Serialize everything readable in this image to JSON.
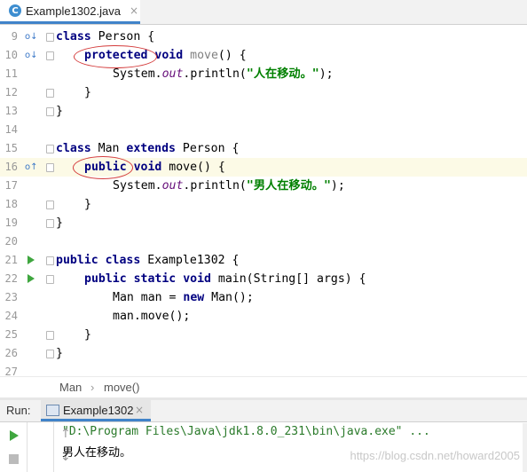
{
  "tab": {
    "icon": "C",
    "label": "Example1302.java",
    "close": "×"
  },
  "lines": [
    {
      "n": "9"
    },
    {
      "n": "10"
    },
    {
      "n": "11"
    },
    {
      "n": "12"
    },
    {
      "n": "13"
    },
    {
      "n": "14"
    },
    {
      "n": "15"
    },
    {
      "n": "16"
    },
    {
      "n": "17"
    },
    {
      "n": "18"
    },
    {
      "n": "19"
    },
    {
      "n": "20"
    },
    {
      "n": "21"
    },
    {
      "n": "22"
    },
    {
      "n": "23"
    },
    {
      "n": "24"
    },
    {
      "n": "25"
    },
    {
      "n": "26"
    },
    {
      "n": "27"
    }
  ],
  "code": {
    "l9": {
      "kw1": "class",
      "t1": " Person {"
    },
    "l10": {
      "kw1": "protected",
      "gap": " ",
      "kw2": "void",
      "g1": " move",
      "t1": "() {"
    },
    "l11": {
      "t1": "System.",
      "fld": "out",
      "t2": ".println(",
      "str": "\"人在移动。\"",
      "t3": ");"
    },
    "l12": {
      "t1": "}"
    },
    "l13": {
      "t1": "}"
    },
    "l15": {
      "kw1": "class",
      "t1": " Man ",
      "kw2": "extends",
      "t2": " Person {"
    },
    "l16": {
      "kw1": "public",
      "gap": " ",
      "kw2": "void",
      "t1": " move() {"
    },
    "l17": {
      "t1": "System.",
      "fld": "out",
      "t2": ".println(",
      "str": "\"男人在移动。\"",
      "t3": ");"
    },
    "l18": {
      "t1": "}"
    },
    "l19": {
      "t1": "}"
    },
    "l21": {
      "kw1": "public",
      "gap1": " ",
      "kw2": "class",
      "t1": " Example1302 {"
    },
    "l22": {
      "kw1": "public",
      "gap1": " ",
      "kw2": "static",
      "gap2": " ",
      "kw3": "void",
      "t1": " main(String[] args) {"
    },
    "l23": {
      "t1": "Man man = ",
      "kw1": "new",
      "t2": " Man();"
    },
    "l24": {
      "t1": "man.move();"
    },
    "l25": {
      "t1": "}"
    },
    "l26": {
      "t1": "}"
    }
  },
  "gutter_marks": {
    "l9": "o↓",
    "l10": "o↓",
    "l16": "o↑"
  },
  "breadcrumb": {
    "item1": "Man",
    "chevron": "›",
    "item2": "move()"
  },
  "run": {
    "label": "Run:",
    "tab_label": "Example1302",
    "close": "×",
    "output_line1": "\"D:\\Program Files\\Java\\jdk1.8.0_231\\bin\\java.exe\" ...",
    "output_line2": "男人在移动。",
    "watermark": "https://blog.csdn.net/howard2005"
  }
}
